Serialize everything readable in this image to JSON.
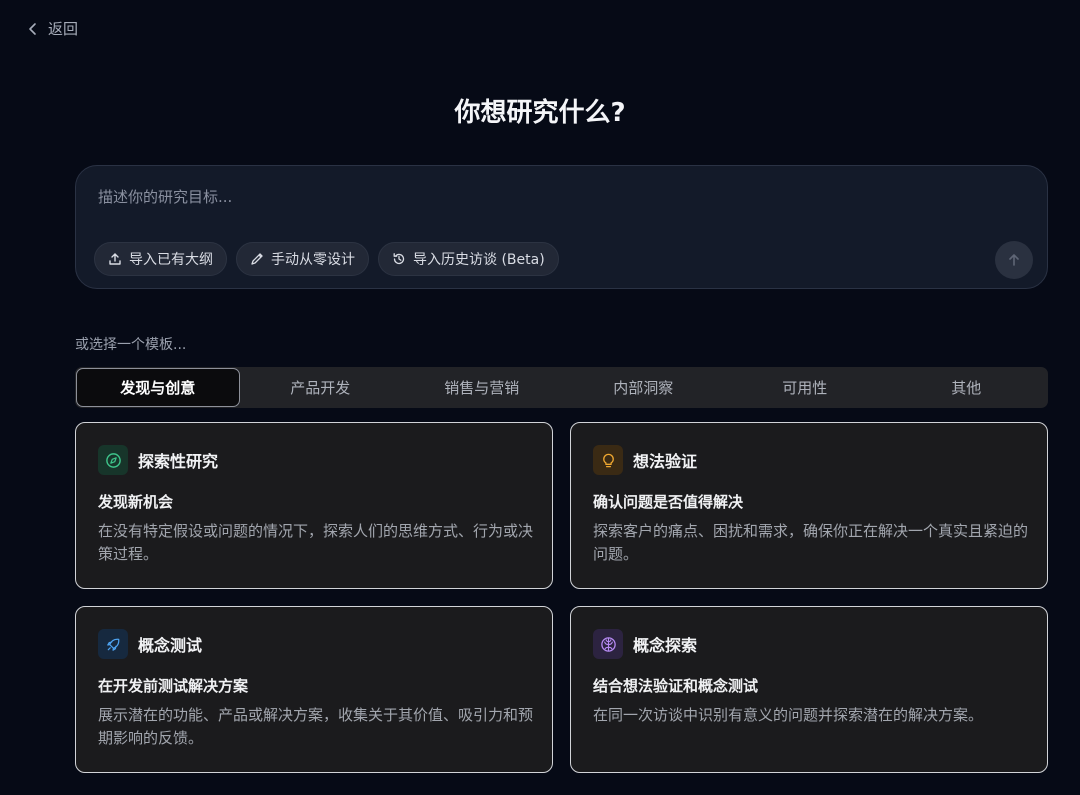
{
  "back": {
    "label": "返回"
  },
  "heading": "你想研究什么?",
  "prompt": {
    "placeholder": "描述你的研究目标...",
    "chips": [
      {
        "icon": "upload-icon",
        "label": "导入已有大纲"
      },
      {
        "icon": "pencil-icon",
        "label": "手动从零设计"
      },
      {
        "icon": "history-icon",
        "label": "导入历史访谈 (Beta)"
      }
    ],
    "send_icon": "arrow-up-icon"
  },
  "templates_label": "或选择一个模板...",
  "tabs": [
    {
      "label": "发现与创意",
      "active": true
    },
    {
      "label": "产品开发",
      "active": false
    },
    {
      "label": "销售与营销",
      "active": false
    },
    {
      "label": "内部洞察",
      "active": false
    },
    {
      "label": "可用性",
      "active": false
    },
    {
      "label": "其他",
      "active": false
    }
  ],
  "cards": [
    {
      "icon": "compass-icon",
      "icon_color": "#3ec48a",
      "icon_bg": "#17352a",
      "title": "探索性研究",
      "subtitle": "发现新机会",
      "description": "在没有特定假设或问题的情况下，探索人们的思维方式、行为或决策过程。"
    },
    {
      "icon": "lightbulb-icon",
      "icon_color": "#f0a830",
      "icon_bg": "#3a2a14",
      "title": "想法验证",
      "subtitle": "确认问题是否值得解决",
      "description": "探索客户的痛点、困扰和需求，确保你正在解决一个真实且紧迫的问题。"
    },
    {
      "icon": "rocket-icon",
      "icon_color": "#4ea3f0",
      "icon_bg": "#16293f",
      "title": "概念测试",
      "subtitle": "在开发前测试解决方案",
      "description": "展示潜在的功能、产品或解决方案，收集关于其价值、吸引力和预期影响的反馈。"
    },
    {
      "icon": "brain-icon",
      "icon_color": "#b68af2",
      "icon_bg": "#2c2340",
      "title": "概念探索",
      "subtitle": "结合想法验证和概念测试",
      "description": "在同一次访谈中识别有意义的问题并探索潜在的解决方案。"
    }
  ]
}
